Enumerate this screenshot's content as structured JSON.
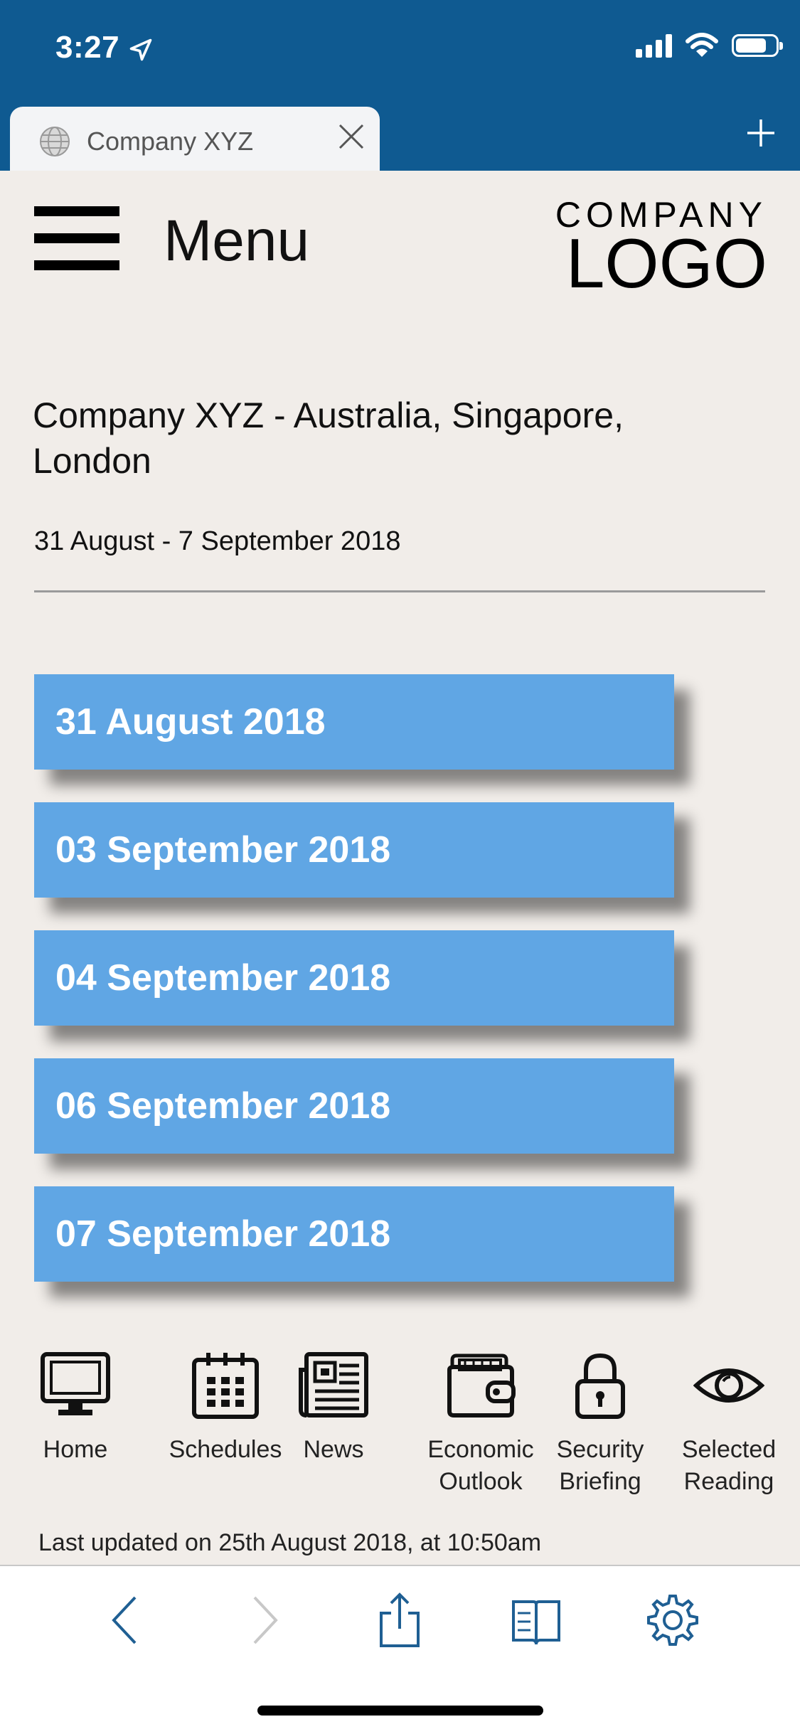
{
  "status_bar": {
    "time": "3:27"
  },
  "browser": {
    "tab_title": "Company XYZ"
  },
  "header": {
    "menu_label": "Menu",
    "logo_top": "COMPANY",
    "logo_bottom": "LOGO"
  },
  "content": {
    "title": "Company XYZ - Australia, Singapore, London",
    "date_range": "31 August - 7 September 2018",
    "dates": [
      "31 August 2018",
      "03 September 2018",
      "04 September 2018",
      "06 September 2018",
      "07 September 2018"
    ]
  },
  "nav": {
    "home": "Home",
    "schedules": "Schedules",
    "news": "News",
    "economic_1": "Economic",
    "economic_2": "Outlook",
    "security_1": "Security",
    "security_2": "Briefing",
    "selected_1": "Selected",
    "selected_2": "Reading"
  },
  "footer": {
    "last_updated": "Last updated on 25th August 2018, at 10:50am"
  },
  "colors": {
    "chrome_blue": "#0f5a91",
    "date_button": "#60a6e4",
    "page_bg": "#f1ede9",
    "toolbar_tint": "#1f5f93"
  }
}
